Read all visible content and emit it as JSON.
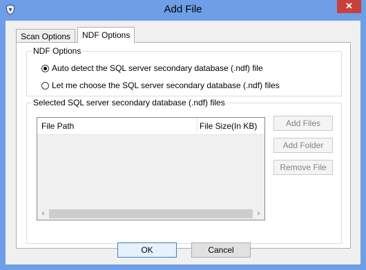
{
  "window": {
    "title": "Add File",
    "close_glyph": "✕",
    "app_icon": "shield-icon"
  },
  "tabs": [
    {
      "label": "Scan Options",
      "selected": false
    },
    {
      "label": "NDF Options",
      "selected": true
    }
  ],
  "ndf_options": {
    "group_label": "NDF Options",
    "radio_auto": {
      "label": "Auto detect the SQL server secondary database (.ndf) file",
      "checked": true
    },
    "radio_manual": {
      "label": "Let me choose the SQL server secondary database (.ndf) files",
      "checked": false
    }
  },
  "selected_files": {
    "group_label": "Selected SQL server  secondary database (.ndf) files",
    "columns": [
      "File Path",
      "File Size(In KB)"
    ],
    "rows": [],
    "scroll_left": "‹",
    "scroll_right": "›"
  },
  "side_buttons": {
    "add_files": "Add Files",
    "add_folder": "Add Folder",
    "remove_file": "Remove File"
  },
  "footer": {
    "ok": "OK",
    "cancel": "Cancel"
  },
  "colors": {
    "titlebar": "#6d9ee6",
    "close": "#c7403a",
    "disabled_text": "#838383"
  }
}
